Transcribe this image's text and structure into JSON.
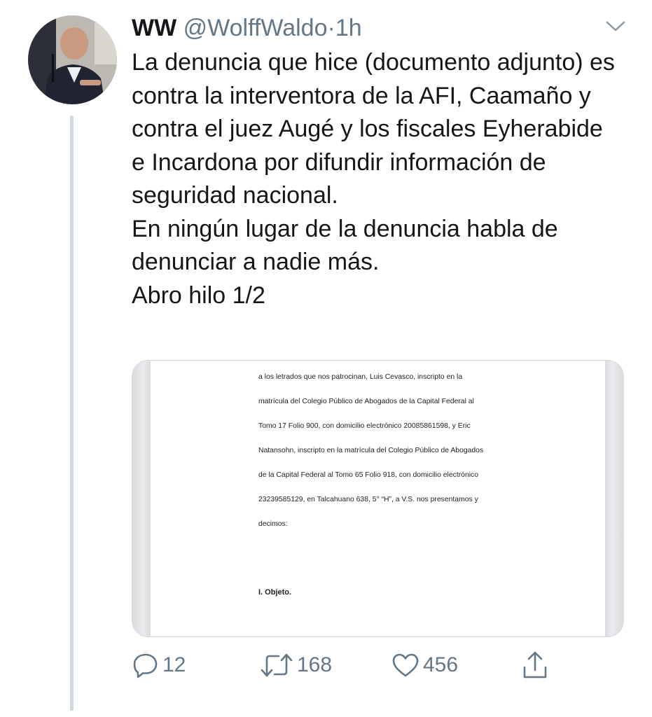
{
  "tweet": {
    "author_name": "WW",
    "handle": "@WolffWaldo",
    "separator": "·",
    "time": "1h",
    "text_lines": [
      "La denuncia que hice (documento adjunto) es contra la interventora de la AFI, Caamaño y contra el juez Augé y los fiscales Eyherabide e Incardona por difundir información de seguridad nacional.",
      "En ningún lugar de la denuncia habla de denunciar a nadie más.",
      "Abro hilo 1/2"
    ]
  },
  "attachment": {
    "lines": [
      "a los letrados que nos patrocinan, Luis Cevasco, inscripto en la",
      "matrícula del Colegio Público de Abogados de la Capital Federal al",
      "Tomo 17 Folio 900, con domicilio electrónico 20085861598, y Eric",
      "Natansohn, inscripto en la matrícula del Colegio Público de Abogados",
      "de la Capital Federal al Tomo 65 Folio 918, con domicilio electrónico",
      "23239585129, en Talcahuano 638, 5° “H”, a V.S. nos presentamos y",
      "decimos:"
    ],
    "heading": "I. Objeto."
  },
  "actions": {
    "reply_count": "12",
    "retweet_count": "168",
    "like_count": "456"
  },
  "icons": {
    "caret": "chevron-down-icon",
    "reply": "reply-icon",
    "retweet": "retweet-icon",
    "like": "heart-icon",
    "share": "share-icon"
  },
  "colors": {
    "text": "#14171a",
    "secondary": "#657786",
    "border": "#cfd9de"
  }
}
